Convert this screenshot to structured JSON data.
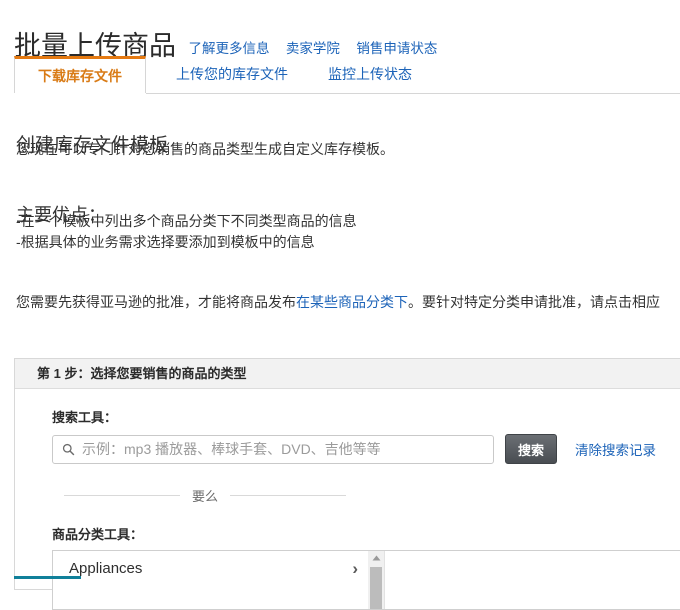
{
  "header": {
    "title": "批量上传商品",
    "links": [
      {
        "name": "learn-more",
        "label": "了解更多信息"
      },
      {
        "name": "seller-university",
        "label": "卖家学院"
      },
      {
        "name": "selling-application-status",
        "label": "销售申请状态"
      }
    ]
  },
  "tabs": [
    {
      "name": "download-inventory-file",
      "label": "下载库存文件",
      "active": true
    },
    {
      "name": "upload-inventory-file",
      "label": "上传您的库存文件",
      "active": false
    },
    {
      "name": "monitor-upload-status",
      "label": "监控上传状态",
      "active": false
    }
  ],
  "intro": {
    "heading": "创建库存文件模板",
    "paragraph": "您现在可以专门针对您销售的商品类型生成自定义库存模板。",
    "benefits_heading": "主要优点：",
    "benefit_1": "-在一个模板中列出多个商品分类下不同类型商品的信息",
    "benefit_2": "-根据具体的业务需求选择要添加到模板中的信息"
  },
  "notice": {
    "text_before_link": "您需要先获得亚马逊的批准，才能将商品发布",
    "link_label": "在某些商品分类下",
    "text_after_link": "。要针对特定分类申请批准，请点击相应"
  },
  "step_panel": {
    "header": "第 1 步：选择您要销售的商品的类型",
    "search": {
      "label": "搜索工具：",
      "icon": "search-icon",
      "value": "",
      "placeholder": "示例：mp3 播放器、棒球手套、DVD、吉他等等",
      "button_label": "搜索",
      "clear_link_label": "清除搜索记录"
    },
    "or_divider_label": "要么",
    "category_tool": {
      "label": "商品分类工具：",
      "items": [
        {
          "name": "appliances",
          "label": "Appliances",
          "chevron": "›"
        }
      ],
      "scrollbar": {
        "up_arrow": "▲"
      }
    }
  },
  "colors": {
    "accent_orange": "#e47911",
    "link_blue": "#1c63b8",
    "button_dark": "#494d52",
    "teal_bar": "#10809a"
  }
}
